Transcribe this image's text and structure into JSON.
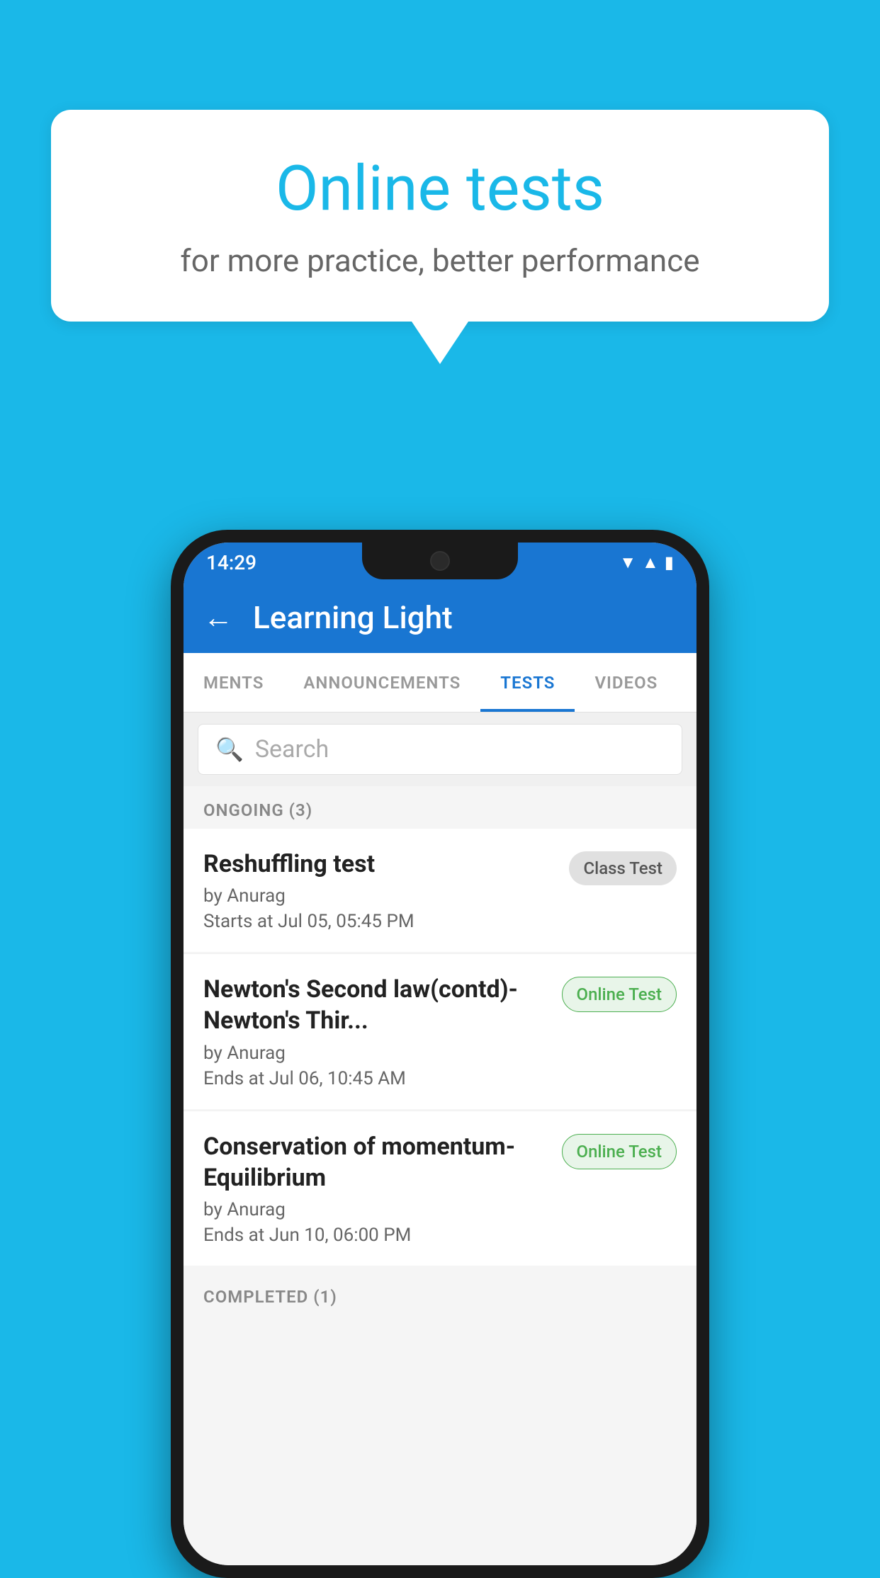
{
  "background_color": "#1ab8e8",
  "speech_bubble": {
    "title": "Online tests",
    "subtitle": "for more practice, better performance"
  },
  "phone": {
    "status_bar": {
      "time": "14:29",
      "icons": [
        "wifi",
        "signal",
        "battery"
      ]
    },
    "app_bar": {
      "title": "Learning Light",
      "back_label": "←"
    },
    "tabs": [
      {
        "label": "MENTS",
        "active": false
      },
      {
        "label": "ANNOUNCEMENTS",
        "active": false
      },
      {
        "label": "TESTS",
        "active": true
      },
      {
        "label": "VIDEOS",
        "active": false
      }
    ],
    "search": {
      "placeholder": "Search"
    },
    "ongoing_section": {
      "header": "ONGOING (3)",
      "items": [
        {
          "title": "Reshuffling test",
          "author": "by Anurag",
          "date": "Starts at  Jul 05, 05:45 PM",
          "badge": "Class Test",
          "badge_type": "class"
        },
        {
          "title": "Newton's Second law(contd)-Newton's Thir...",
          "author": "by Anurag",
          "date": "Ends at  Jul 06, 10:45 AM",
          "badge": "Online Test",
          "badge_type": "online"
        },
        {
          "title": "Conservation of momentum-Equilibrium",
          "author": "by Anurag",
          "date": "Ends at  Jun 10, 06:00 PM",
          "badge": "Online Test",
          "badge_type": "online"
        }
      ]
    },
    "completed_section": {
      "header": "COMPLETED (1)"
    }
  }
}
